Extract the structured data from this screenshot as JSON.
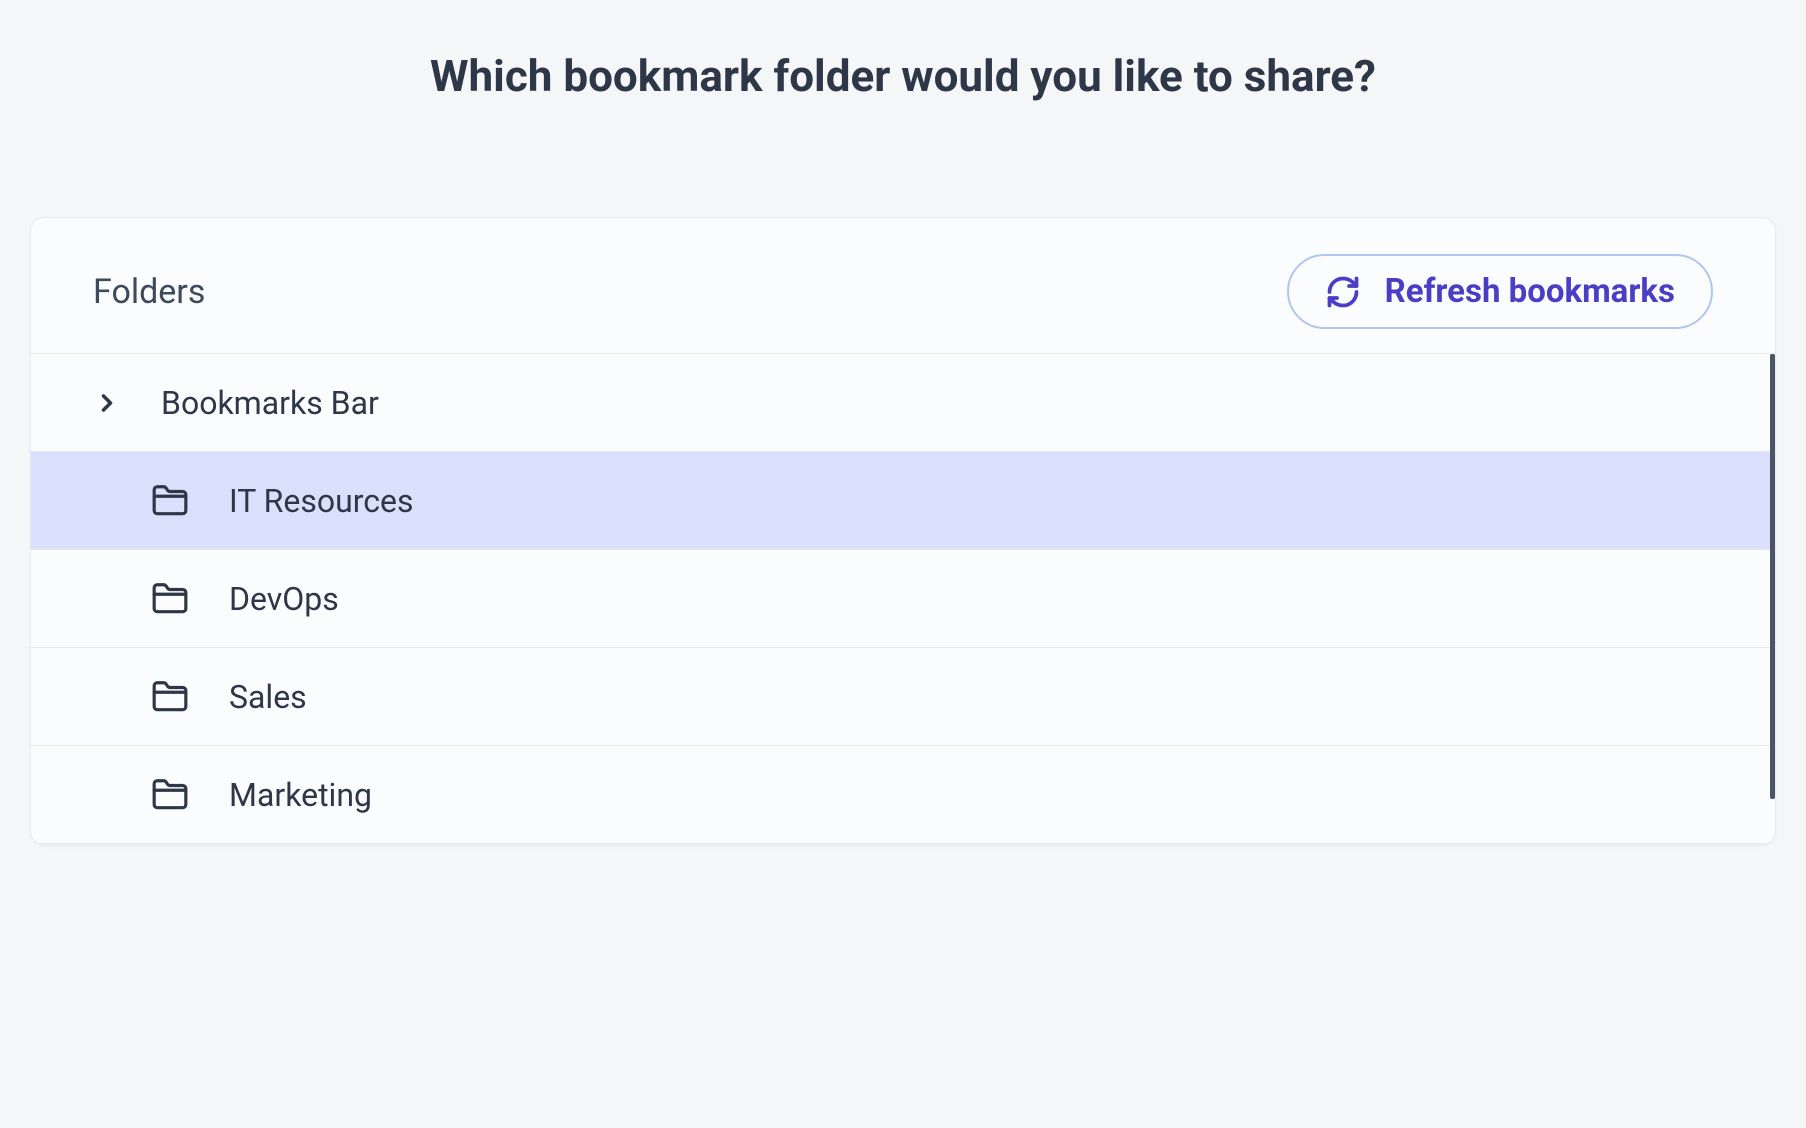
{
  "title": "Which bookmark folder would you like to share?",
  "header": {
    "folders_label": "Folders",
    "refresh_label": "Refresh bookmarks"
  },
  "root_folder": {
    "name": "Bookmarks Bar"
  },
  "folders": [
    {
      "name": "IT Resources",
      "selected": true
    },
    {
      "name": "DevOps",
      "selected": false
    },
    {
      "name": "Sales",
      "selected": false
    },
    {
      "name": "Marketing",
      "selected": false
    }
  ]
}
